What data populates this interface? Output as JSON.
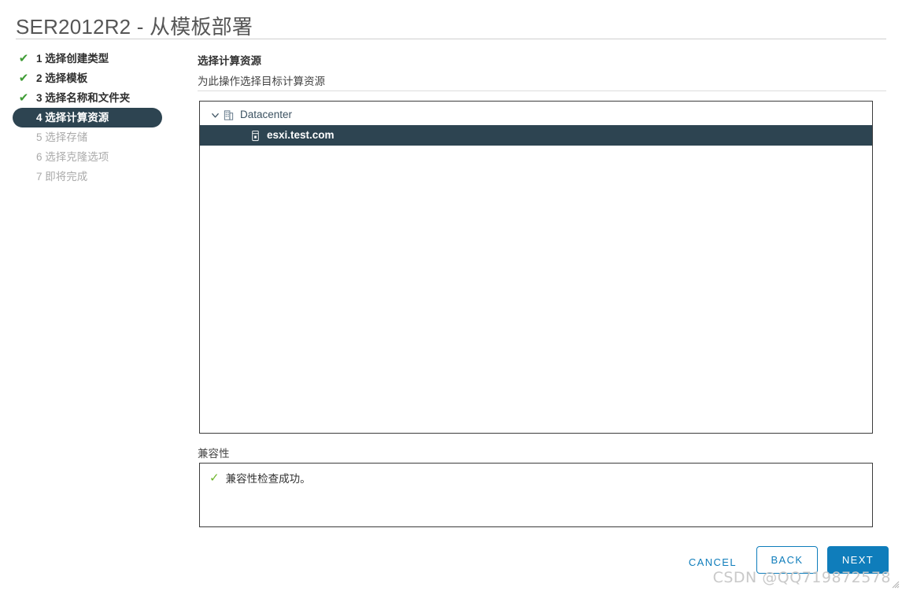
{
  "window": {
    "title": "SER2012R2 - 从模板部署"
  },
  "steps": [
    {
      "number": "1",
      "label": "选择创建类型",
      "state": "done"
    },
    {
      "number": "2",
      "label": "选择模板",
      "state": "done"
    },
    {
      "number": "3",
      "label": "选择名称和文件夹",
      "state": "done"
    },
    {
      "number": "4",
      "label": "选择计算资源",
      "state": "current"
    },
    {
      "number": "5",
      "label": "选择存储",
      "state": "todo"
    },
    {
      "number": "6",
      "label": "选择克隆选项",
      "state": "todo"
    },
    {
      "number": "7",
      "label": "即将完成",
      "state": "todo"
    }
  ],
  "main": {
    "heading": "选择计算资源",
    "subheading": "为此操作选择目标计算资源"
  },
  "tree": {
    "nodes": [
      {
        "label": "Datacenter",
        "icon": "datacenter-icon",
        "level": 0,
        "expanded": true,
        "selected": false
      },
      {
        "label": "esxi.test.com",
        "icon": "host-icon",
        "level": 1,
        "expanded": false,
        "selected": true
      }
    ]
  },
  "compatibility": {
    "label": "兼容性",
    "message": "兼容性检查成功。",
    "status": "success"
  },
  "footer": {
    "cancel_label": "CANCEL",
    "back_label": "BACK",
    "next_label": "NEXT"
  },
  "watermark": {
    "text": "CSDN @QQ719872578"
  },
  "colors": {
    "accent_blue": "#0f7dbb",
    "selection_dark": "#2d4451",
    "check_green": "#3f9c35",
    "compat_green": "#6eb52b",
    "title_gray": "#565656"
  }
}
